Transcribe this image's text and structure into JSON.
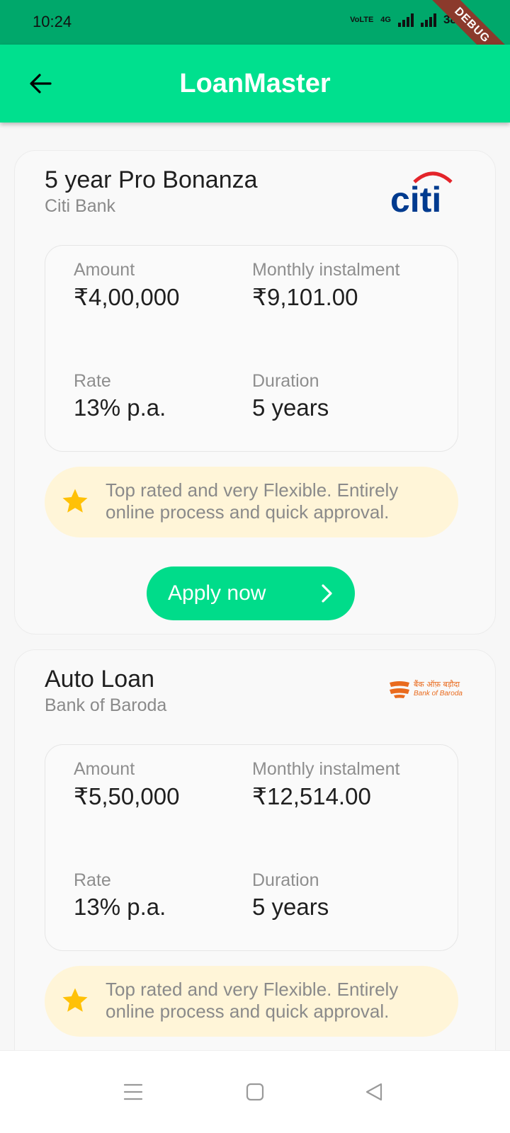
{
  "status_bar": {
    "time": "10:24",
    "network": "VoLTE",
    "signal_label": "4G",
    "battery": "38%",
    "debug_banner": "DEBUG"
  },
  "app_bar": {
    "title": "LoanMaster"
  },
  "loans": [
    {
      "title": "5 year Pro Bonanza",
      "bank": "Citi Bank",
      "logo_text": "citi",
      "details": {
        "amount_label": "Amount",
        "amount": "₹4,00,000",
        "emi_label": "Monthly instalment",
        "emi": "₹9,101.00",
        "rate_label": "Rate",
        "rate": "13% p.a.",
        "duration_label": "Duration",
        "duration": "5 years"
      },
      "highlight": "Top rated and very Flexible. Entirely online process and quick approval.",
      "apply_label": "Apply now"
    },
    {
      "title": "Auto Loan",
      "bank": "Bank of Baroda",
      "logo_text_hi": "बैंक ऑफ़ बड़ौदा",
      "logo_text_en": "Bank of Baroda",
      "details": {
        "amount_label": "Amount",
        "amount": "₹5,50,000",
        "emi_label": "Monthly instalment",
        "emi": "₹12,514.00",
        "rate_label": "Rate",
        "rate": "13% p.a.",
        "duration_label": "Duration",
        "duration": "5 years"
      },
      "highlight": "Top rated and very Flexible. Entirely online process and quick approval."
    }
  ],
  "icons": [
    "back-arrow-icon",
    "star-icon",
    "chevron-right-icon",
    "menu-icon",
    "home-icon",
    "back-icon"
  ],
  "colors": {
    "status_bar": "#00a86b",
    "app_bar": "#00e08e",
    "button": "#00dc8a",
    "highlight_bg": "#fff5d8",
    "star": "#ffc107"
  }
}
